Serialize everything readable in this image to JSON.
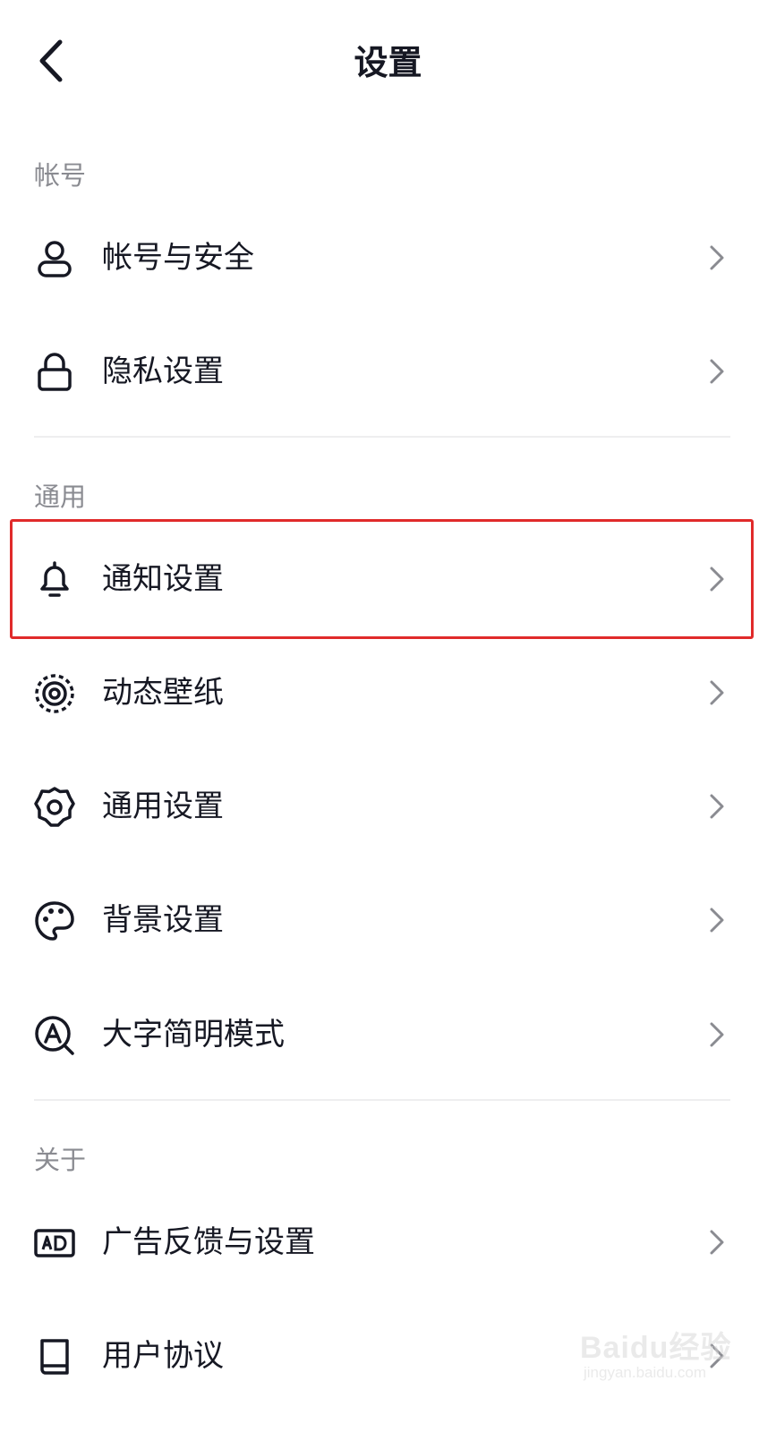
{
  "header": {
    "title": "设置",
    "back_icon": "chevron-left-icon"
  },
  "sections": [
    {
      "label": "帐号",
      "items": [
        {
          "label": "帐号与安全",
          "icon": "user-icon"
        },
        {
          "label": "隐私设置",
          "icon": "lock-icon"
        }
      ]
    },
    {
      "label": "通用",
      "items": [
        {
          "label": "通知设置",
          "icon": "bell-icon"
        },
        {
          "label": "动态壁纸",
          "icon": "target-icon"
        },
        {
          "label": "通用设置",
          "icon": "gear-icon"
        },
        {
          "label": "背景设置",
          "icon": "palette-icon"
        },
        {
          "label": "大字简明模式",
          "icon": "large-font-icon"
        }
      ]
    },
    {
      "label": "关于",
      "items": [
        {
          "label": "广告反馈与设置",
          "icon": "ad-icon"
        },
        {
          "label": "用户协议",
          "icon": "book-icon"
        }
      ]
    }
  ],
  "highlight": {
    "color": "#e02a2a",
    "target": "通知设置"
  },
  "watermark": {
    "logo": "Baidu经验",
    "url": "jingyan.baidu.com"
  },
  "colors": {
    "text": "#161823",
    "section_label": "#8a8b91",
    "chevron": "#8a8b91",
    "divider": "#eeeeef"
  }
}
